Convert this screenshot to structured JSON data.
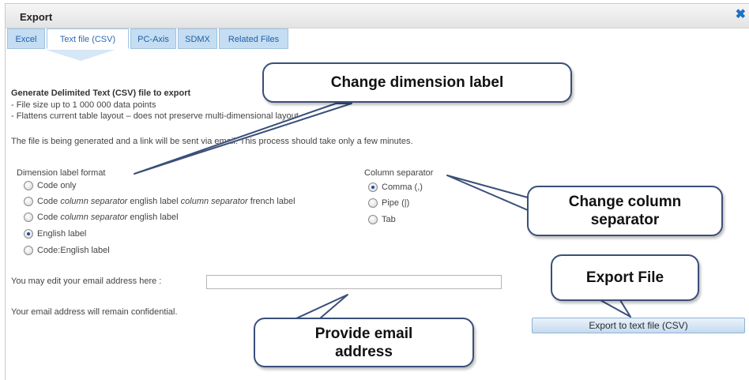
{
  "dialog": {
    "title": "Export",
    "close_glyph": "✖"
  },
  "tabs": [
    {
      "label": "Excel",
      "active": false
    },
    {
      "label": "Text file (CSV)",
      "active": true
    },
    {
      "label": "PC-Axis",
      "active": false
    },
    {
      "label": "SDMX",
      "active": false
    },
    {
      "label": "Related Files",
      "active": false
    }
  ],
  "content": {
    "heading": "Generate Delimited Text (CSV) file to export",
    "bullet1": "- File size up to 1 000 000 data points",
    "bullet2": "- Flattens current table layout – does not preserve multi-dimensional layout",
    "info": "The file is being generated and a link will be sent via email. This process should take only a few minutes."
  },
  "dimension_label": {
    "label": "Dimension label format",
    "options": [
      {
        "parts": [
          "Code only"
        ],
        "checked": false
      },
      {
        "parts": [
          "Code ",
          "column separator",
          " english label ",
          "column separator",
          " french label"
        ],
        "checked": false
      },
      {
        "parts": [
          "Code ",
          "column separator",
          " english label"
        ],
        "checked": false
      },
      {
        "parts": [
          "English label"
        ],
        "checked": true
      },
      {
        "parts": [
          "Code:English label"
        ],
        "checked": false
      }
    ]
  },
  "column_separator": {
    "label": "Column separator",
    "options": [
      {
        "label": "Comma (,)",
        "checked": true
      },
      {
        "label": "Pipe (|)",
        "checked": false
      },
      {
        "label": "Tab",
        "checked": false
      }
    ]
  },
  "email": {
    "label": "You may edit your email address here :",
    "value": "",
    "note": "Your email address will remain confidential."
  },
  "export_button": "Export to text file (CSV)",
  "callouts": {
    "dimension": "Change dimension label",
    "separator": "Change column separator",
    "export": "Export File",
    "email": "Provide email address"
  },
  "colors": {
    "tab_bg": "#c4ddf2",
    "tab_text": "#1f5fa8",
    "callout_border": "#3a4f79",
    "close": "#1a73c6"
  }
}
